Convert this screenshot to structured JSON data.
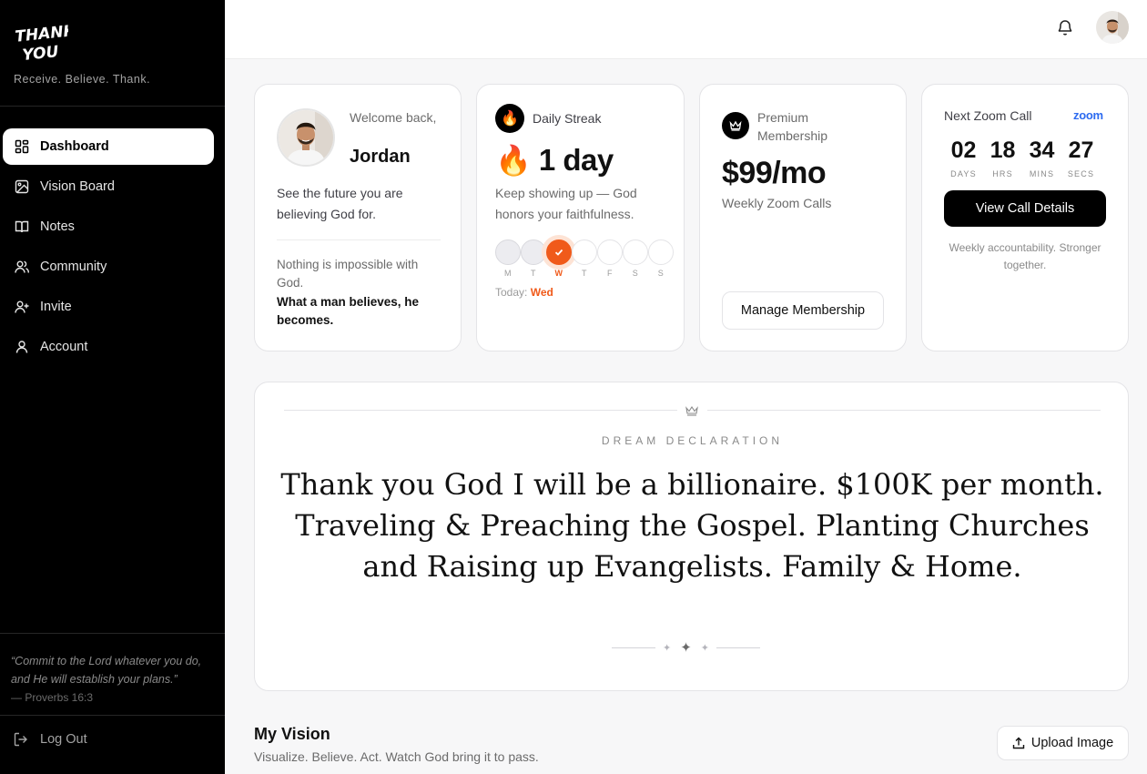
{
  "brand": {
    "logo_text_line1": "THANK",
    "logo_text_line2": "YOU",
    "tagline": "Receive. Believe. Thank."
  },
  "sidebar": {
    "items": [
      {
        "label": "Dashboard",
        "icon": "dashboard-icon",
        "active": true
      },
      {
        "label": "Vision Board",
        "icon": "image-icon"
      },
      {
        "label": "Notes",
        "icon": "book-icon"
      },
      {
        "label": "Community",
        "icon": "users-icon"
      },
      {
        "label": "Invite",
        "icon": "user-plus-icon"
      },
      {
        "label": "Account",
        "icon": "user-icon"
      }
    ],
    "verse": "“Commit to the Lord whatever you do, and He will establish your plans.”",
    "verse_ref": "— Proverbs 16:3",
    "logout_label": "Log Out"
  },
  "topbar": {
    "bell_icon": "bell-icon",
    "avatar": "user-avatar"
  },
  "welcome_card": {
    "greeting": "Welcome back,",
    "name": "Jordan",
    "description": "See the future you are believing God for.",
    "quote": "Nothing is impossible with God.",
    "quote_strong": "What a man believes, he becomes."
  },
  "streak_card": {
    "title": "Daily Streak",
    "flame": "🔥",
    "value": "1 day",
    "description": "Keep showing up — God honors your faithfulness.",
    "days": [
      {
        "label": "M",
        "state": "done"
      },
      {
        "label": "T",
        "state": "done"
      },
      {
        "label": "W",
        "state": "today"
      },
      {
        "label": "T",
        "state": "empty"
      },
      {
        "label": "F",
        "state": "empty"
      },
      {
        "label": "S",
        "state": "empty"
      },
      {
        "label": "S",
        "state": "empty"
      }
    ],
    "today_prefix": "Today:",
    "today_value": "Wed",
    "accent_color": "#f05a1a"
  },
  "membership_card": {
    "title": "Premium Membership",
    "price": "$99/mo",
    "subtitle": "Weekly Zoom Calls",
    "button_label": "Manage Membership"
  },
  "zoom_card": {
    "title": "Next Zoom Call",
    "logo": "zoom",
    "countdown": [
      {
        "value": "02",
        "unit": "DAYS"
      },
      {
        "value": "18",
        "unit": "HRS"
      },
      {
        "value": "34",
        "unit": "MINS"
      },
      {
        "value": "27",
        "unit": "SECS"
      }
    ],
    "button_label": "View Call Details",
    "note": "Weekly accountability. Stronger together."
  },
  "dream": {
    "label": "DREAM DECLARATION",
    "text": "Thank you God I will be a billionaire. $100K per month. Traveling & Preaching the Gospel. Planting Churches and Raising up Evangelists. Family & Home."
  },
  "vision": {
    "title": "My Vision",
    "subtitle": "Visualize. Believe. Act. Watch God bring it to pass.",
    "upload_label": "Upload Image"
  }
}
